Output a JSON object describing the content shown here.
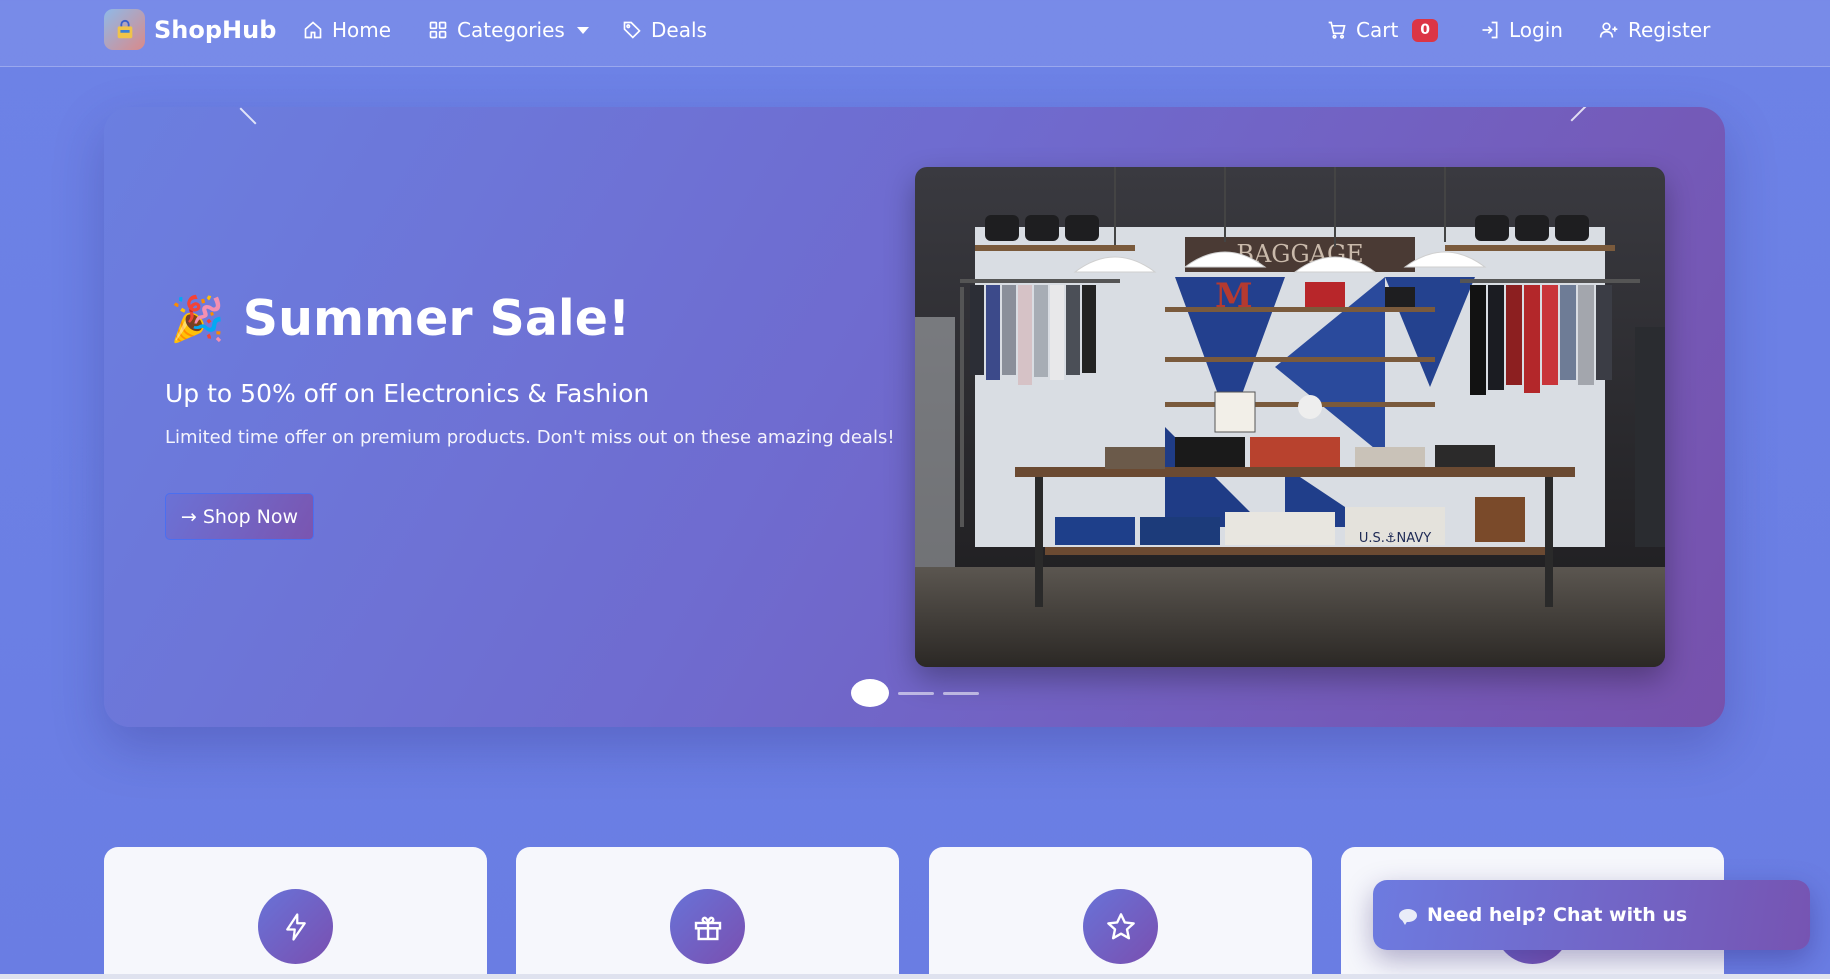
{
  "navbar": {
    "brand": "ShopHub",
    "links": {
      "home": "Home",
      "categories": "Categories",
      "deals": "Deals",
      "cart": "Cart",
      "cart_count": "0",
      "login": "Login",
      "register": "Register"
    }
  },
  "hero": {
    "title_emoji": "🎉",
    "title": "Summer Sale!",
    "subtitle": "Up to 50% off on Electronics & Fashion",
    "description": "Limited time offer on premium products. Don't miss out on these amazing deals!",
    "cta_label": "Shop Now",
    "slides_total": 3,
    "active_slide": 1
  },
  "features": [
    {
      "icon": "lightning-icon"
    },
    {
      "icon": "gift-icon"
    },
    {
      "icon": "star-icon"
    },
    {
      "icon": "feature-icon"
    }
  ],
  "chat": {
    "label": "Need help? Chat with us"
  },
  "colors": {
    "background": "#6d82e6",
    "accent_purple": "#7751ac",
    "badge_red": "#dc3545"
  }
}
